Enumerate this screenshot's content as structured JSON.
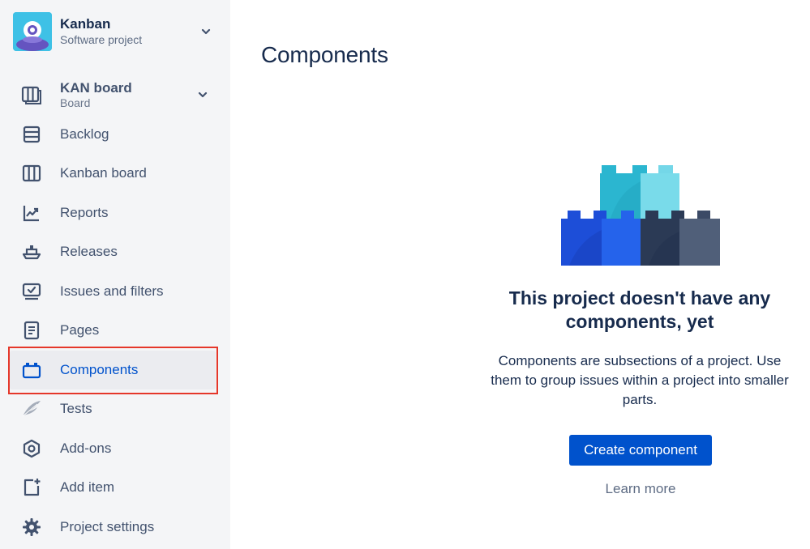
{
  "project": {
    "name": "Kanban",
    "type": "Software project"
  },
  "board": {
    "name": "KAN board",
    "type": "Board"
  },
  "sidebar": {
    "items": [
      {
        "label": "Backlog",
        "icon": "backlog-icon"
      },
      {
        "label": "Kanban board",
        "icon": "board-columns-icon"
      },
      {
        "label": "Reports",
        "icon": "reports-chart-icon"
      },
      {
        "label": "Releases",
        "icon": "ship-icon"
      },
      {
        "label": "Issues and filters",
        "icon": "issues-monitor-icon"
      },
      {
        "label": "Pages",
        "icon": "page-icon"
      },
      {
        "label": "Components",
        "icon": "components-icon",
        "active": true
      },
      {
        "label": "Tests",
        "icon": "wing-icon"
      },
      {
        "label": "Add-ons",
        "icon": "hexagon-icon"
      },
      {
        "label": "Add item",
        "icon": "add-item-icon"
      },
      {
        "label": "Project settings",
        "icon": "gear-icon"
      }
    ]
  },
  "main": {
    "title": "Components",
    "empty_state": {
      "heading": "This project doesn't have any components, yet",
      "description": "Components are subsections of a project. Use them to group issues within a project into smaller parts.",
      "primary_button": "Create component",
      "secondary_link": "Learn more"
    }
  },
  "colors": {
    "sidebar_bg": "#f4f5f7",
    "active_text": "#0052cc",
    "primary_button": "#0052cc",
    "highlight_outline": "#e5372a",
    "heading_text": "#172b4d"
  }
}
